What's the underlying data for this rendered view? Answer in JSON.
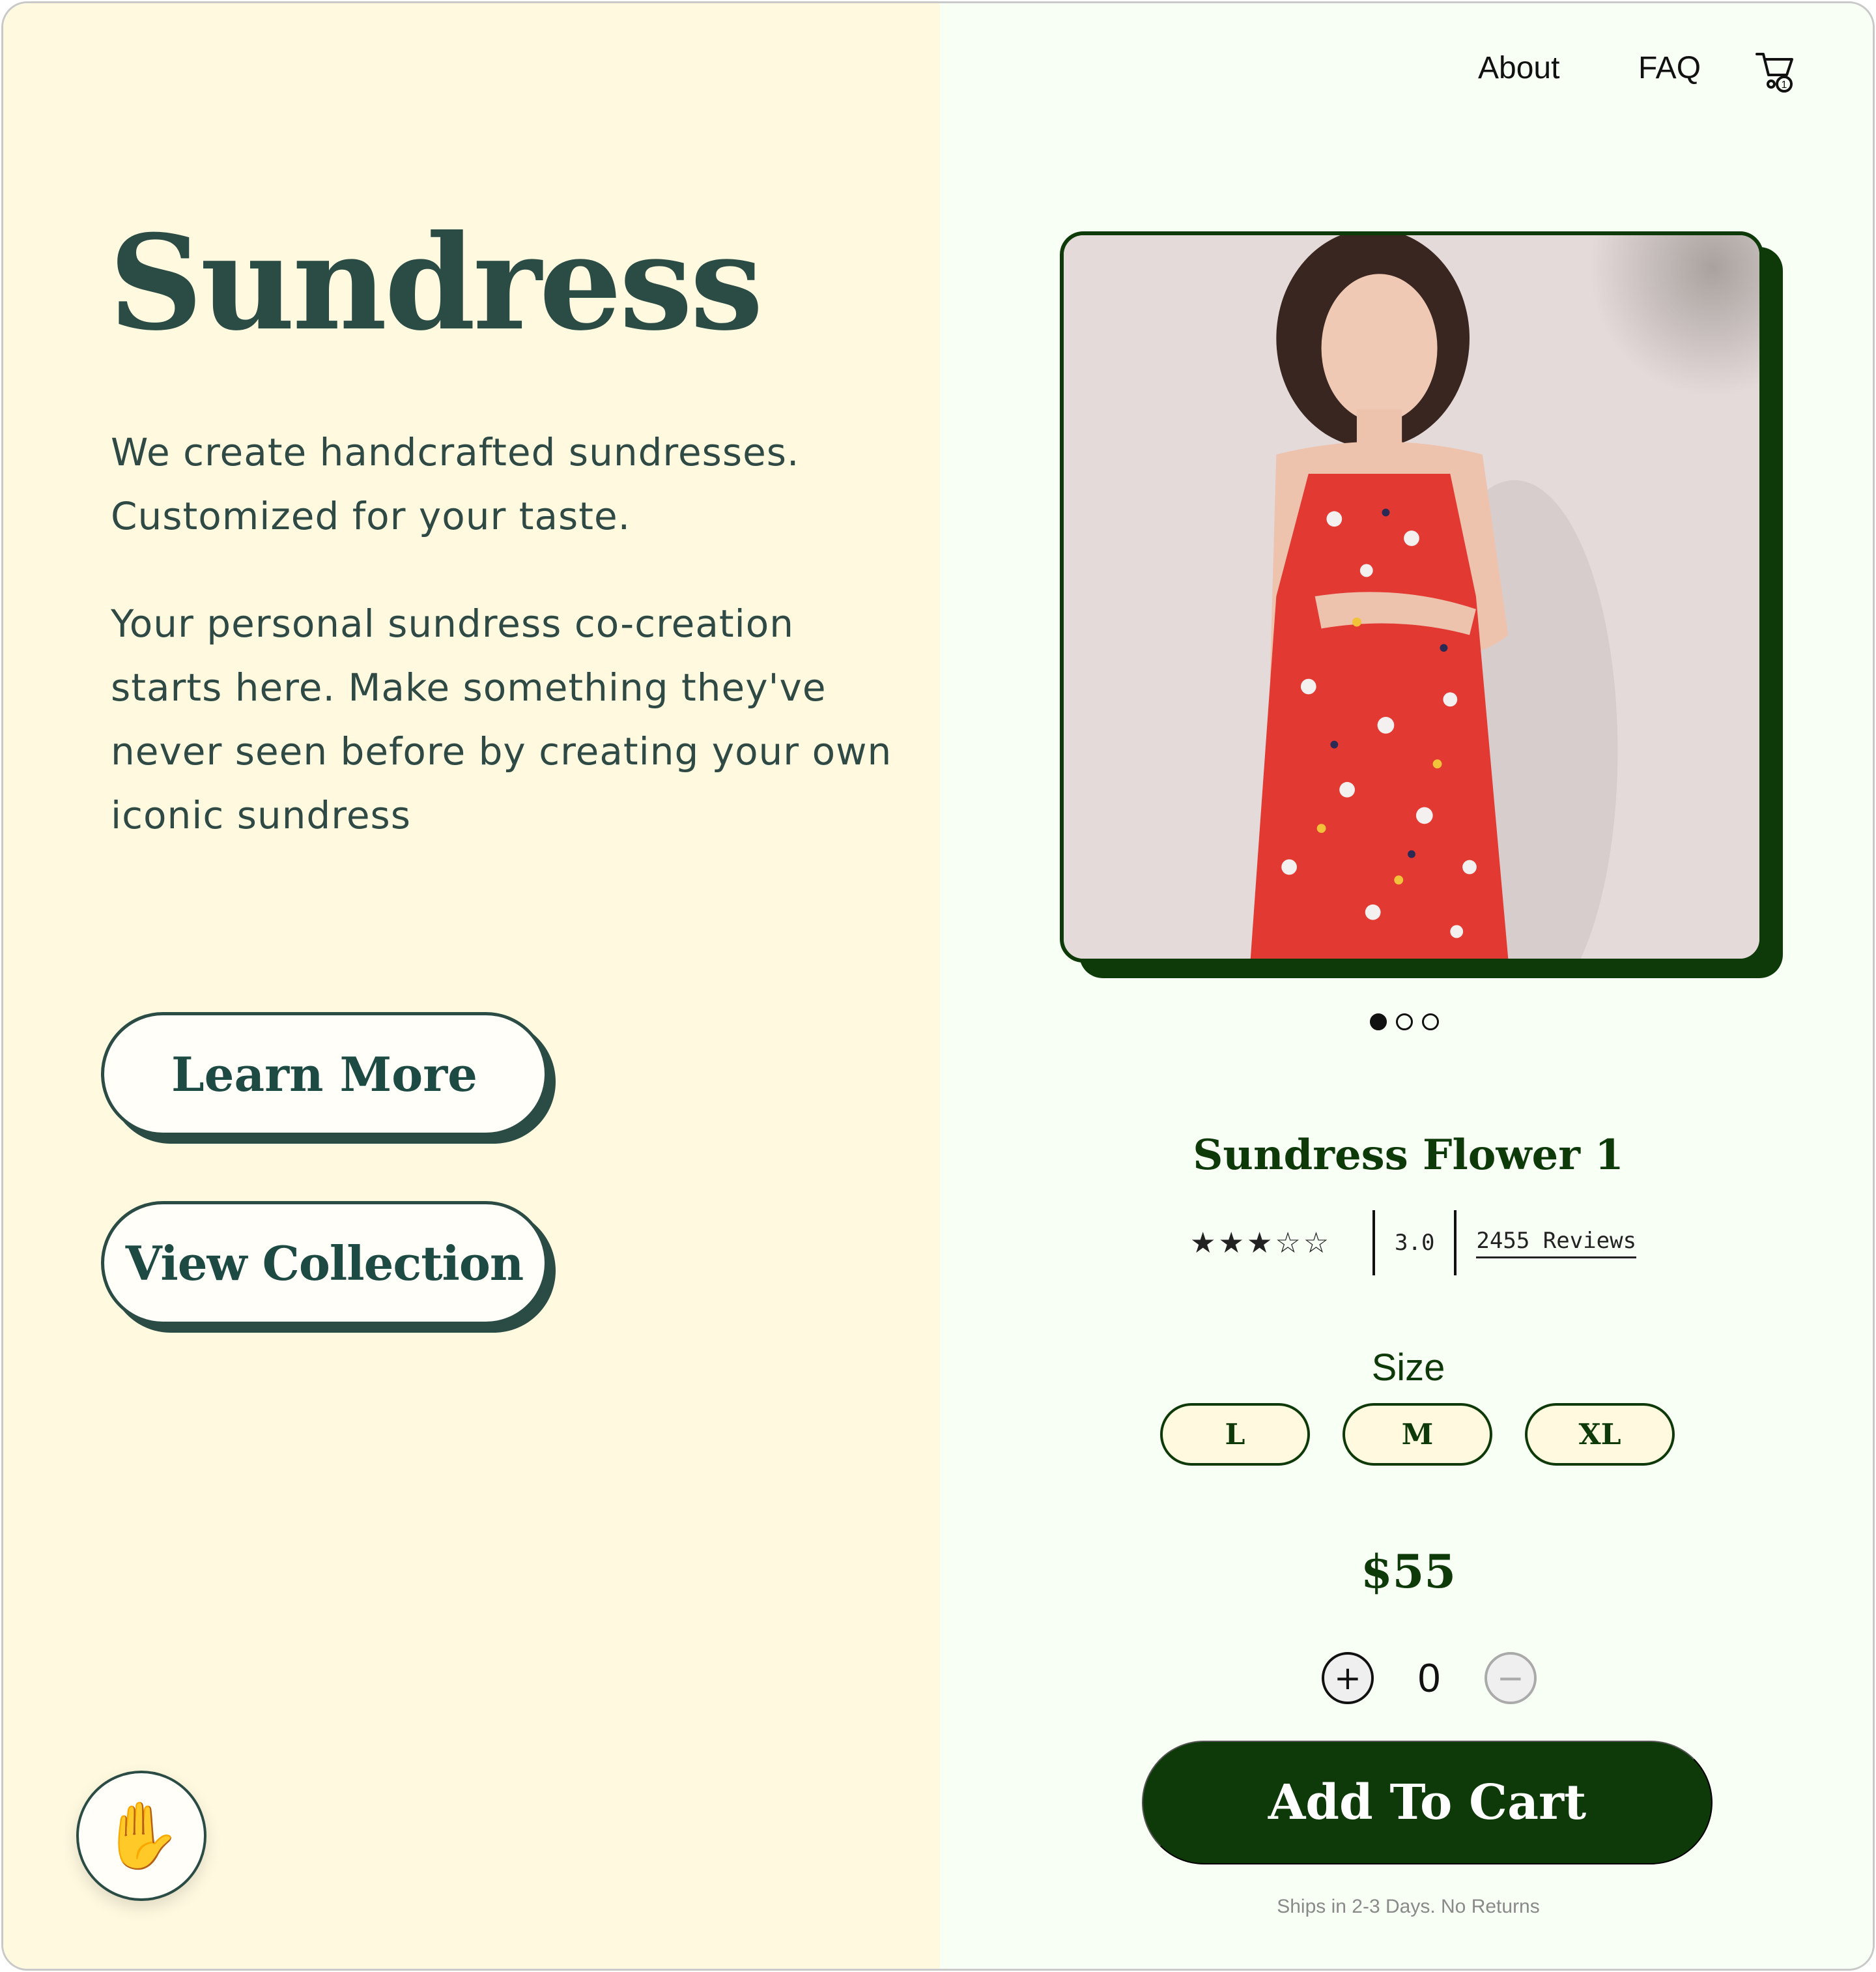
{
  "hero": {
    "title": "Sundress",
    "paragraph1": "We create handcrafted sundresses. Customized for your taste.",
    "paragraph2": "Your personal sundress co-creation starts here. Make something they've never seen before by creating your own iconic sundress",
    "learn_more_label": "Learn More",
    "view_collection_label": "View Collection",
    "wave_icon": "waving-hand-icon"
  },
  "nav": {
    "about_label": "About",
    "faq_label": "FAQ",
    "cart_icon": "cart-icon",
    "cart_count": "1"
  },
  "product": {
    "name": "Sundress Flower 1",
    "stars": "★★★☆☆",
    "star_rating": 3,
    "rating_value": "3.0",
    "reviews_label": "2455 Reviews",
    "carousel_total": 3,
    "carousel_active": 0,
    "size_label": "Size",
    "sizes": [
      "L",
      "M",
      "XL"
    ],
    "price": "$55",
    "quantity": "0",
    "plus_symbol": "+",
    "minus_symbol": "−",
    "add_to_cart_label": "Add To Cart",
    "shipping_note": "Ships in 2-3 Days. No Returns"
  },
  "colors": {
    "left_bg": "#fff9e0",
    "right_bg": "#f8fff5",
    "brand_dark_green": "#0e3a0a",
    "teal_dark": "#2b4b45",
    "dress_red": "#e23a33"
  }
}
